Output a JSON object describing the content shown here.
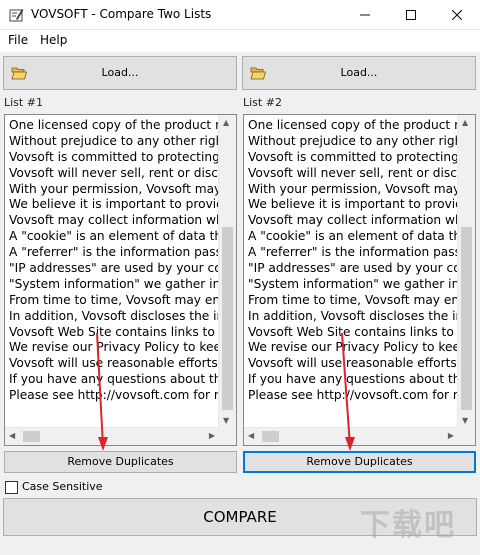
{
  "window": {
    "title": "VOVSOFT - Compare Two Lists",
    "controls": {
      "minimize": "minimize-icon",
      "maximize": "maximize-icon",
      "close": "close-icon"
    }
  },
  "menu": {
    "file": "File",
    "help": "Help"
  },
  "left": {
    "load_label": "Load...",
    "list_label": "List #1",
    "lines": [
      "One licensed copy of the product ma",
      "Without prejudice to any other right",
      "Vovsoft is committed to protecting y",
      "Vovsoft will never sell, rent or disclo",
      "With your permission, Vovsoft may :",
      "We believe it is important to provide",
      "Vovsoft may collect information whi",
      "A \"cookie\" is an element of data tha",
      "A \"referrer\" is the information passe",
      "\"IP addresses\" are used by your cor",
      "\"System information\" we gather inc",
      "From time to time, Vovsoft may ent",
      "In addition, Vovsoft discloses the inf",
      "Vovsoft Web Site contains links to o",
      "We revise our Privacy Policy to keep",
      "Vovsoft will use reasonable efforts t",
      "If you have any questions about this",
      "Please see http://vovsoft.com for m"
    ],
    "remove_label": "Remove Duplicates"
  },
  "right": {
    "load_label": "Load...",
    "list_label": "List #2",
    "lines": [
      "One licensed copy of the product ma",
      "Without prejudice to any other right",
      "Vovsoft is committed to protecting y",
      "Vovsoft will never sell, rent or disclo",
      "With your permission, Vovsoft may :",
      "We believe it is important to provide",
      "Vovsoft may collect information whi",
      "A \"cookie\" is an element of data tha",
      "A \"referrer\" is the information passe",
      "\"IP addresses\" are used by your cor",
      "\"System information\" we gather inc",
      "From time to time, Vovsoft may ent",
      "In addition, Vovsoft discloses the inf",
      "Vovsoft Web Site contains links to o",
      "We revise our Privacy Policy to keep",
      "Vovsoft will use reasonable efforts t",
      "If you have any questions about this",
      "Please see http://vovsoft.com for m"
    ],
    "remove_label": "Remove Duplicates"
  },
  "case_sensitive": {
    "label": "Case Sensitive",
    "checked": false
  },
  "compare_label": "COMPARE",
  "watermark": "下载吧",
  "colors": {
    "annotation_arrow": "#d9262b",
    "focus_border": "#0078d7"
  }
}
